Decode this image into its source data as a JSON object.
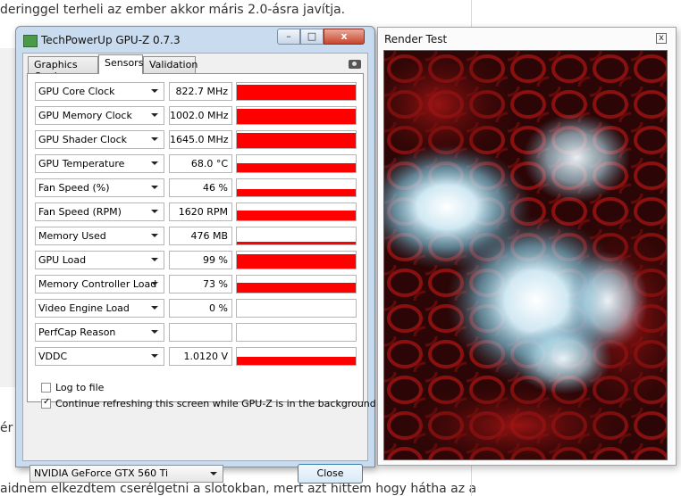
{
  "article": {
    "line1": "deringgel terheli az ember akkor máris 2.0-ásra javítja.",
    "line2": "ér",
    "line3": "aidnem elkezdtem cserélgetni a slotokban, mert azt hittem hogy hátha az a"
  },
  "gpuz": {
    "title": "TechPowerUp GPU-Z 0.7.3",
    "caption_buttons": {
      "minimize": "–",
      "maximize": "□",
      "close": "x"
    },
    "tabs": [
      {
        "label": "Graphics Card"
      },
      {
        "label": "Sensors"
      },
      {
        "label": "Validation"
      }
    ],
    "active_tab": "Sensors",
    "sensors": [
      {
        "name": "GPU Core Clock",
        "value": "822.7 MHz",
        "level": 0.9
      },
      {
        "name": "GPU Memory Clock",
        "value": "1002.0 MHz",
        "level": 0.9
      },
      {
        "name": "GPU Shader Clock",
        "value": "1645.0 MHz",
        "level": 0.9
      },
      {
        "name": "GPU Temperature",
        "value": "68.0 °C",
        "level": 0.5
      },
      {
        "name": "Fan Speed (%)",
        "value": "46 %",
        "level": 0.4
      },
      {
        "name": "Fan Speed (RPM)",
        "value": "1620 RPM",
        "level": 0.6
      },
      {
        "name": "Memory Used",
        "value": "476 MB",
        "level": 0.15
      },
      {
        "name": "GPU Load",
        "value": "99 %",
        "level": 0.85
      },
      {
        "name": "Memory Controller Load",
        "value": "73 %",
        "level": 0.6
      },
      {
        "name": "Video Engine Load",
        "value": "0 %",
        "level": 0
      },
      {
        "name": "PerfCap Reason",
        "value": "",
        "level": 0
      },
      {
        "name": "VDDC",
        "value": "1.0120 V",
        "level": 0.45
      }
    ],
    "log_to_file": {
      "label": "Log to file",
      "checked": false
    },
    "continue_refreshing": {
      "label": "Continue refreshing this screen while GPU-Z is in the background",
      "checked": true
    },
    "gpu_select": "NVIDIA GeForce GTX 560 Ti",
    "close_label": "Close"
  },
  "render": {
    "title": "Render Test",
    "close": "x"
  },
  "colors": {
    "sensor_bar": "#ff0000",
    "window_frame": "#c9dbef",
    "render_dark": "#2a0606"
  }
}
